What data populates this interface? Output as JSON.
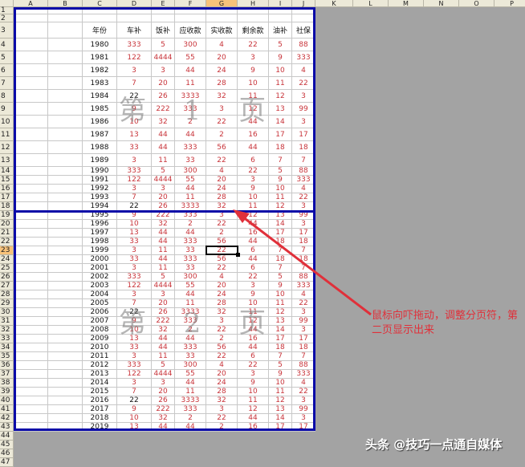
{
  "columns": [
    "A",
    "B",
    "C",
    "D",
    "E",
    "F",
    "G",
    "H",
    "I",
    "J",
    "K",
    "L",
    "M",
    "N",
    "O",
    "P"
  ],
  "selected_column": "G",
  "selected_row": 23,
  "row_numbers": [
    1,
    2,
    3,
    4,
    5,
    6,
    7,
    8,
    9,
    10,
    11,
    12,
    13,
    14,
    15,
    16,
    17,
    18,
    19,
    20,
    21,
    22,
    23,
    24,
    25,
    26,
    27,
    28,
    29,
    30,
    31,
    32,
    33,
    34,
    35,
    36,
    37,
    38,
    39,
    40,
    41,
    42,
    43,
    44,
    45,
    46,
    47
  ],
  "table": {
    "headers": [
      "年份",
      "车补",
      "饭补",
      "应收款",
      "实收款",
      "剩余款",
      "油补",
      "社保"
    ],
    "rows": [
      {
        "year": "1980",
        "values": [
          "333",
          "5",
          "300",
          "4",
          "22",
          "5",
          "88"
        ]
      },
      {
        "year": "1981",
        "values": [
          "122",
          "4444",
          "55",
          "20",
          "3",
          "9",
          "333"
        ]
      },
      {
        "year": "1982",
        "values": [
          "3",
          "3",
          "44",
          "24",
          "9",
          "10",
          "4"
        ]
      },
      {
        "year": "1983",
        "values": [
          "7",
          "20",
          "11",
          "28",
          "10",
          "11",
          "22"
        ]
      },
      {
        "year": "1984",
        "values": [
          "22",
          "26",
          "3333",
          "32",
          "11",
          "12",
          "3"
        ],
        "first_dark": true
      },
      {
        "year": "1985",
        "values": [
          "9",
          "222",
          "333",
          "3",
          "12",
          "13",
          "99"
        ]
      },
      {
        "year": "1986",
        "values": [
          "10",
          "32",
          "2",
          "22",
          "44",
          "14",
          "3"
        ]
      },
      {
        "year": "1987",
        "values": [
          "13",
          "44",
          "44",
          "2",
          "16",
          "17",
          "17"
        ]
      },
      {
        "year": "1988",
        "values": [
          "33",
          "44",
          "333",
          "56",
          "44",
          "18",
          "18"
        ]
      },
      {
        "year": "1989",
        "values": [
          "3",
          "11",
          "33",
          "22",
          "6",
          "7",
          "7"
        ]
      },
      {
        "year": "1990",
        "values": [
          "333",
          "5",
          "300",
          "4",
          "22",
          "5",
          "88"
        ]
      },
      {
        "year": "1991",
        "values": [
          "122",
          "4444",
          "55",
          "20",
          "3",
          "9",
          "333"
        ]
      },
      {
        "year": "1992",
        "values": [
          "3",
          "3",
          "44",
          "24",
          "9",
          "10",
          "4"
        ]
      },
      {
        "year": "1993",
        "values": [
          "7",
          "20",
          "11",
          "28",
          "10",
          "11",
          "22"
        ]
      },
      {
        "year": "1994",
        "values": [
          "22",
          "26",
          "3333",
          "32",
          "11",
          "12",
          "3"
        ],
        "first_dark": true
      },
      {
        "year": "1995",
        "values": [
          "9",
          "222",
          "333",
          "3",
          "12",
          "13",
          "99"
        ]
      },
      {
        "year": "1996",
        "values": [
          "10",
          "32",
          "2",
          "22",
          "44",
          "14",
          "3"
        ]
      },
      {
        "year": "1997",
        "values": [
          "13",
          "44",
          "44",
          "2",
          "16",
          "17",
          "17"
        ]
      },
      {
        "year": "1998",
        "values": [
          "33",
          "44",
          "333",
          "56",
          "44",
          "18",
          "18"
        ]
      },
      {
        "year": "1999",
        "values": [
          "3",
          "11",
          "33",
          "22",
          "6",
          "7",
          "7"
        ]
      },
      {
        "year": "2000",
        "values": [
          "33",
          "44",
          "333",
          "56",
          "44",
          "18",
          "18"
        ]
      },
      {
        "year": "2001",
        "values": [
          "3",
          "11",
          "33",
          "22",
          "6",
          "7",
          "7"
        ]
      },
      {
        "year": "2002",
        "values": [
          "333",
          "5",
          "300",
          "4",
          "22",
          "5",
          "88"
        ]
      },
      {
        "year": "2003",
        "values": [
          "122",
          "4444",
          "55",
          "20",
          "3",
          "9",
          "333"
        ]
      },
      {
        "year": "2004",
        "values": [
          "3",
          "3",
          "44",
          "24",
          "9",
          "10",
          "4"
        ]
      },
      {
        "year": "2005",
        "values": [
          "7",
          "20",
          "11",
          "28",
          "10",
          "11",
          "22"
        ]
      },
      {
        "year": "2006",
        "values": [
          "22",
          "26",
          "3333",
          "32",
          "11",
          "12",
          "3"
        ],
        "first_dark": true
      },
      {
        "year": "2007",
        "values": [
          "9",
          "222",
          "333",
          "3",
          "12",
          "13",
          "99"
        ]
      },
      {
        "year": "2008",
        "values": [
          "10",
          "32",
          "2",
          "22",
          "44",
          "14",
          "3"
        ]
      },
      {
        "year": "2009",
        "values": [
          "13",
          "44",
          "44",
          "2",
          "16",
          "17",
          "17"
        ]
      },
      {
        "year": "2010",
        "values": [
          "33",
          "44",
          "333",
          "56",
          "44",
          "18",
          "18"
        ]
      },
      {
        "year": "2011",
        "values": [
          "3",
          "11",
          "33",
          "22",
          "6",
          "7",
          "7"
        ]
      },
      {
        "year": "2012",
        "values": [
          "333",
          "5",
          "300",
          "4",
          "22",
          "5",
          "88"
        ]
      },
      {
        "year": "2013",
        "values": [
          "122",
          "4444",
          "55",
          "20",
          "3",
          "9",
          "333"
        ]
      },
      {
        "year": "2014",
        "values": [
          "3",
          "3",
          "44",
          "24",
          "9",
          "10",
          "4"
        ]
      },
      {
        "year": "2015",
        "values": [
          "7",
          "20",
          "11",
          "28",
          "10",
          "11",
          "22"
        ]
      },
      {
        "year": "2016",
        "values": [
          "22",
          "26",
          "3333",
          "32",
          "11",
          "12",
          "3"
        ],
        "first_dark": true
      },
      {
        "year": "2017",
        "values": [
          "9",
          "222",
          "333",
          "3",
          "12",
          "13",
          "99"
        ]
      },
      {
        "year": "2018",
        "values": [
          "10",
          "32",
          "2",
          "22",
          "44",
          "14",
          "3"
        ]
      },
      {
        "year": "2019",
        "values": [
          "13",
          "44",
          "44",
          "2",
          "16",
          "17",
          "17"
        ]
      }
    ]
  },
  "watermarks": {
    "page1": "第 1 页",
    "page2": "第 2 页"
  },
  "annotation": "鼠标向吓拖动，调整分页符，第二页显示出来",
  "credit": "头条 @技巧一点通自媒体",
  "colors": {
    "value": "#c8343a",
    "page_border": "#0b0ba8",
    "annotation": "#e0303a"
  }
}
